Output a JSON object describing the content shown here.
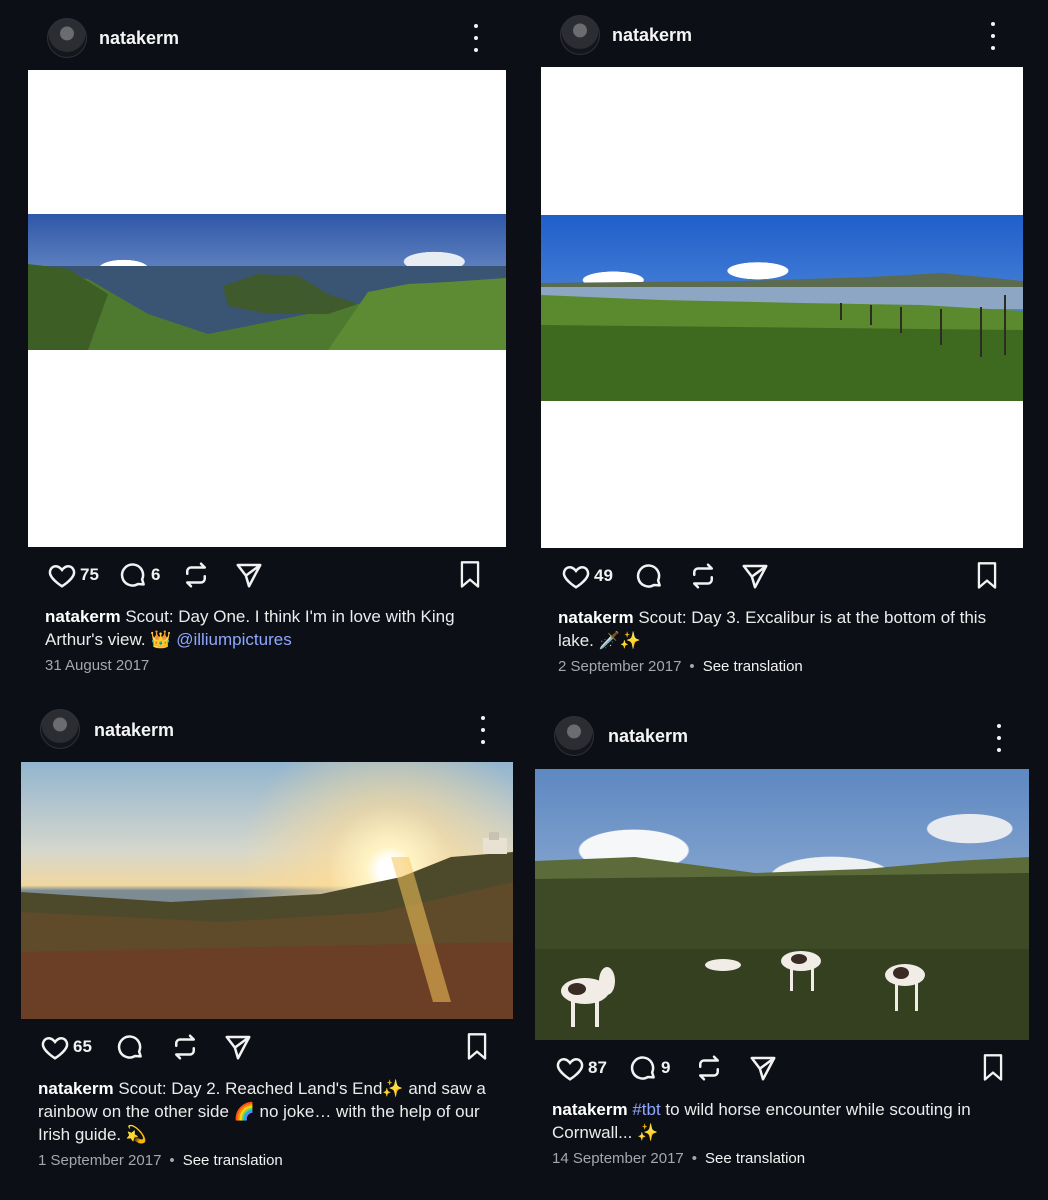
{
  "icons": {
    "avatar": "avatar-photo",
    "more": "more-vertical-icon",
    "like": "heart-icon",
    "comment": "comment-bubble-icon",
    "repost": "repost-icon",
    "share": "send-icon",
    "save": "bookmark-icon"
  },
  "colors": {
    "background": "#0c0f16",
    "mention": "#8ea8ff"
  },
  "posts": [
    {
      "username": "natakerm",
      "likes": "75",
      "comments": "6",
      "caption_user": "natakerm",
      "caption_text": "Scout: Day One. I think I'm in love with King Arthur's view. 👑",
      "mention": "@illiumpictures",
      "date": "31 August 2017"
    },
    {
      "username": "natakerm",
      "likes": "49",
      "caption_user": "natakerm",
      "caption_text": "Scout: Day 3. Excalibur is at the bottom of this lake. 🗡️✨",
      "date": "2 September 2017",
      "translation": "See translation"
    },
    {
      "username": "natakerm",
      "likes": "65",
      "caption_user": "natakerm",
      "caption_text": "Scout: Day 2. Reached Land's End✨ and saw a rainbow on the other side 🌈 no joke… with the help of our Irish guide. 💫",
      "date": "1 September 2017",
      "translation": "See translation"
    },
    {
      "username": "natakerm",
      "likes": "87",
      "comments": "9",
      "caption_user": "natakerm",
      "hashtag": "#tbt",
      "caption_text": " to wild horse encounter while scouting in Cornwall... ✨",
      "date": "14 September 2017",
      "translation": "See translation"
    }
  ]
}
